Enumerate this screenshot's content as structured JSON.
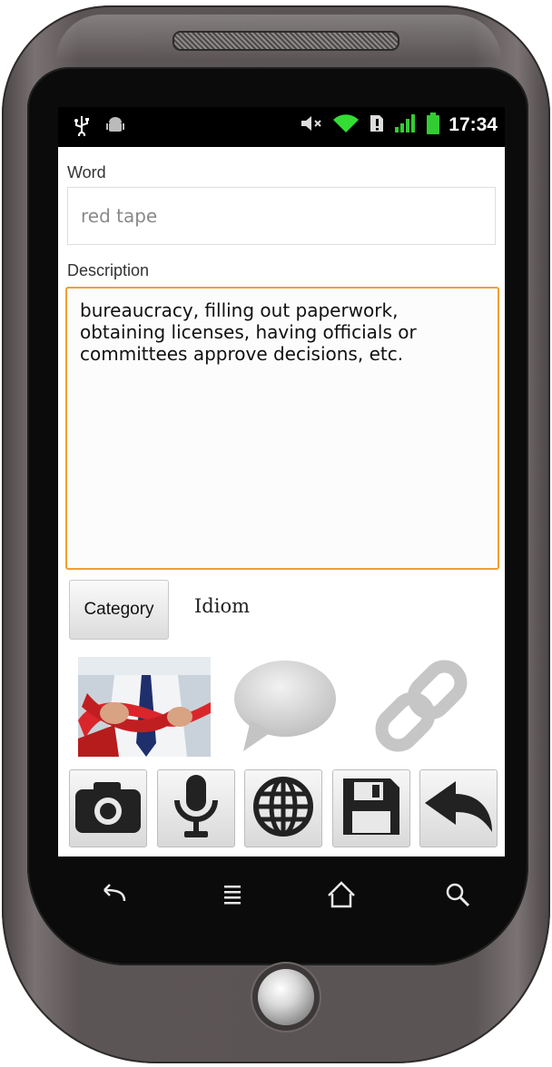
{
  "status_bar": {
    "time": "17:34",
    "icons": [
      "usb-icon",
      "android-debug-icon",
      "mute-icon",
      "wifi-icon",
      "sim-alert-icon",
      "signal-icon",
      "battery-icon"
    ]
  },
  "form": {
    "word_label": "Word",
    "word_value": "red tape",
    "description_label": "Description",
    "description_value": "bureaucracy, filling out paperwork,\nobtaining licenses, having officials or\ncommittees approve decisions, etc.",
    "category_button": "Category",
    "category_value": "Idiom"
  },
  "media": {
    "icons": [
      "photo-thumbnail",
      "speech-bubble-icon",
      "link-icon"
    ]
  },
  "toolbar": {
    "buttons": [
      "camera-icon",
      "microphone-icon",
      "globe-icon",
      "save-icon",
      "back-icon"
    ]
  },
  "nav_bar": {
    "icons": [
      "nav-back-icon",
      "nav-menu-icon",
      "nav-home-icon",
      "nav-search-icon"
    ]
  },
  "colors": {
    "focus_border": "#f0a030",
    "status_bar_bg": "#000000",
    "wifi_green": "#33dd33"
  }
}
